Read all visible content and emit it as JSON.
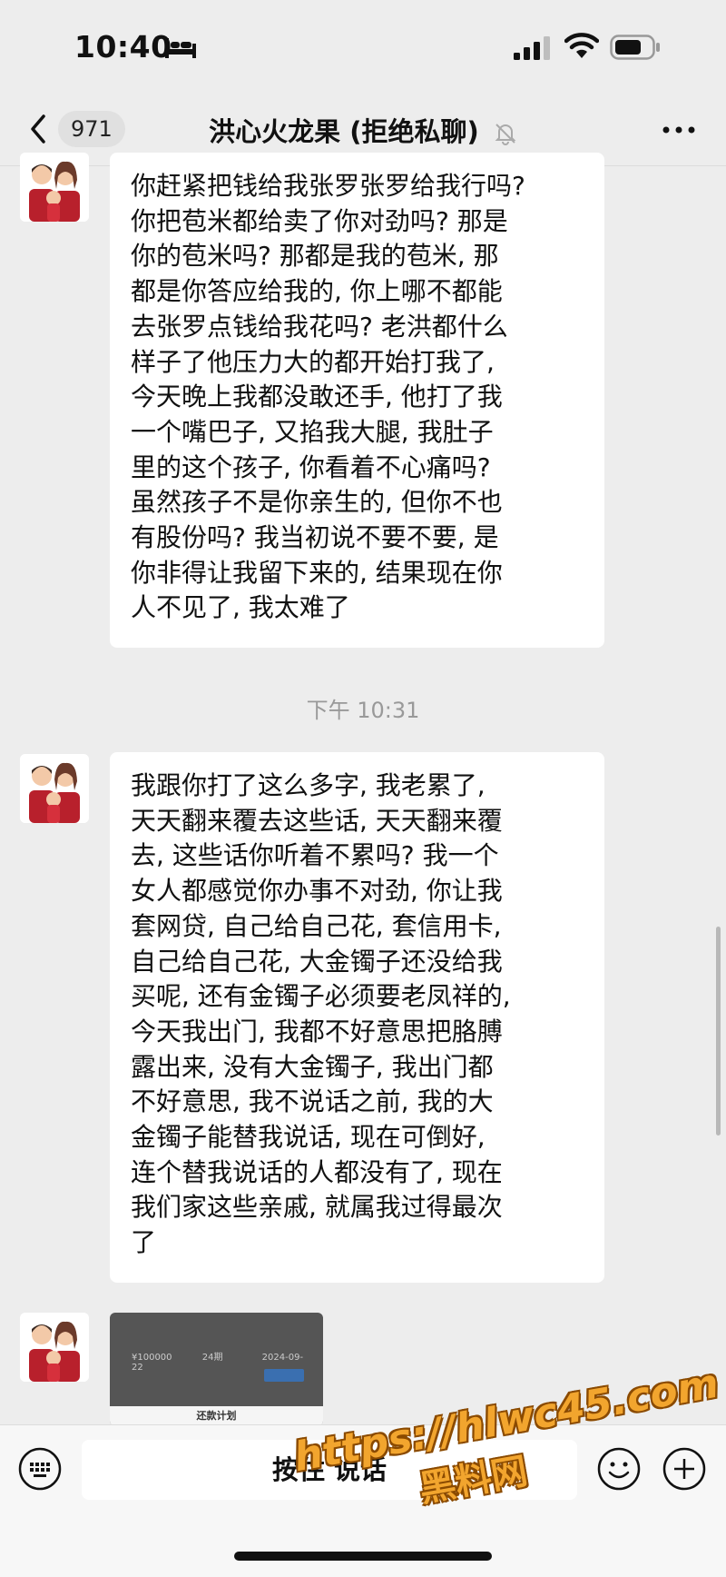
{
  "status_bar": {
    "time": "10:40"
  },
  "nav": {
    "unread_count": "971",
    "title": "洪心火龙果 (拒绝私聊)"
  },
  "messages": [
    {
      "type": "text",
      "lines": [
        "你赶紧把钱给我张罗张罗给我行吗?",
        "你把苞米都给卖了你对劲吗? 那是",
        "你的苞米吗? 那都是我的苞米, 那",
        "都是你答应给我的, 你上哪不都能",
        "去张罗点钱给我花吗? 老洪都什么",
        "样子了他压力大的都开始打我了,",
        "今天晚上我都没敢还手, 他打了我",
        "一个嘴巴子, 又掐我大腿, 我肚子",
        "里的这个孩子, 你看着不心痛吗?",
        "虽然孩子不是你亲生的, 但你不也",
        "有股份吗? 我当初说不要不要, 是",
        "你非得让我留下来的, 结果现在你",
        "人不见了, 我太难了"
      ]
    },
    {
      "type": "text",
      "lines": [
        "我跟你打了这么多字, 我老累了,",
        "天天翻来覆去这些话, 天天翻来覆",
        "去, 这些话你听着不累吗? 我一个",
        "女人都感觉你办事不对劲, 你让我",
        "套网贷, 自己给自己花, 套信用卡,",
        "自己给自己花, 大金镯子还没给我",
        "买呢, 还有金镯子必须要老凤祥的,",
        "今天我出门, 我都不好意思把胳膊",
        "露出来, 没有大金镯子, 我出门都",
        "不好意思, 我不说话之前, 我的大",
        "金镯子能替我说话, 现在可倒好,",
        "连个替我说话的人都没有了, 现在",
        "我们家这些亲戚, 就属我过得最次",
        "了"
      ]
    }
  ],
  "timestamp": "下午 10:31",
  "image_message": {
    "row": [
      "¥100000",
      "24期",
      "2024-09-22"
    ],
    "footer": "还款计划"
  },
  "input_bar": {
    "hold_to_talk": "按住 说话"
  },
  "watermark": {
    "url": "https://hlwc45.com",
    "name": "黑料网"
  }
}
